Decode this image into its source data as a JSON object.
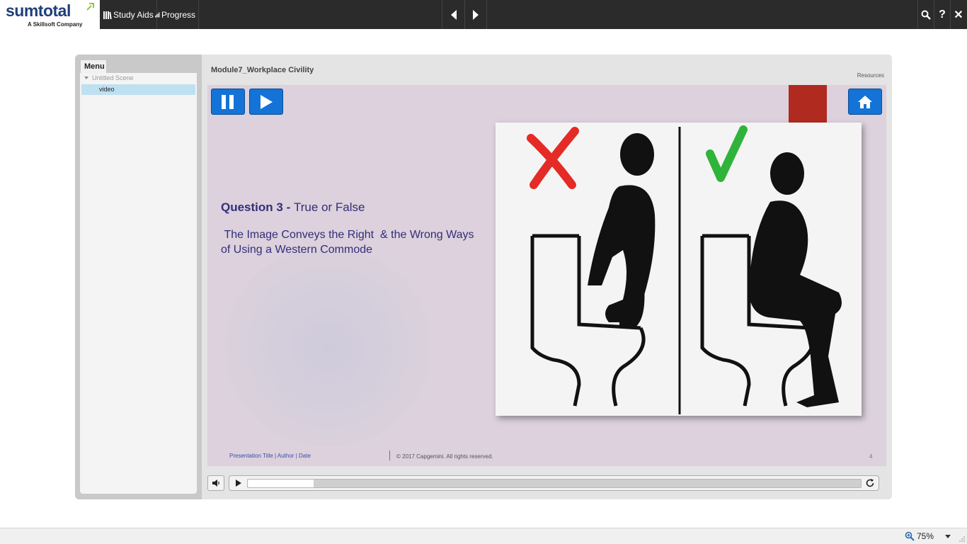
{
  "app": {
    "logo_main": "sumtotal",
    "logo_sub": "A Skillsoft Company"
  },
  "toolbar": {
    "study_aids": "Study Aids",
    "progress": "Progress",
    "search_icon": "search-icon",
    "help_label": "?",
    "close_label": "✕"
  },
  "sidebar": {
    "menu_tab": "Menu",
    "scene_label": "Untitled Scene",
    "items": [
      {
        "label": "video",
        "selected": true
      }
    ]
  },
  "content": {
    "module_title": "Module7_Workplace Civility",
    "resources": "Resources"
  },
  "slide": {
    "question_strong": "Question 3 - ",
    "question_type": "True or False",
    "question_body": " The Image Conveys the Right  & the Wrong Ways of Using a Western Commode",
    "footer_left": "Presentation Title  |  Author  |  Date",
    "footer_right": "© 2017 Capgemini. All rights reserved.",
    "page_number": "4",
    "colors": {
      "button_blue": "#1373d6",
      "wrong_mark": "#e52b25",
      "right_mark": "#2fb33a",
      "text": "#332e7a"
    }
  },
  "playbar": {
    "progress_fraction": 0.107
  },
  "status": {
    "zoom": "75%"
  }
}
